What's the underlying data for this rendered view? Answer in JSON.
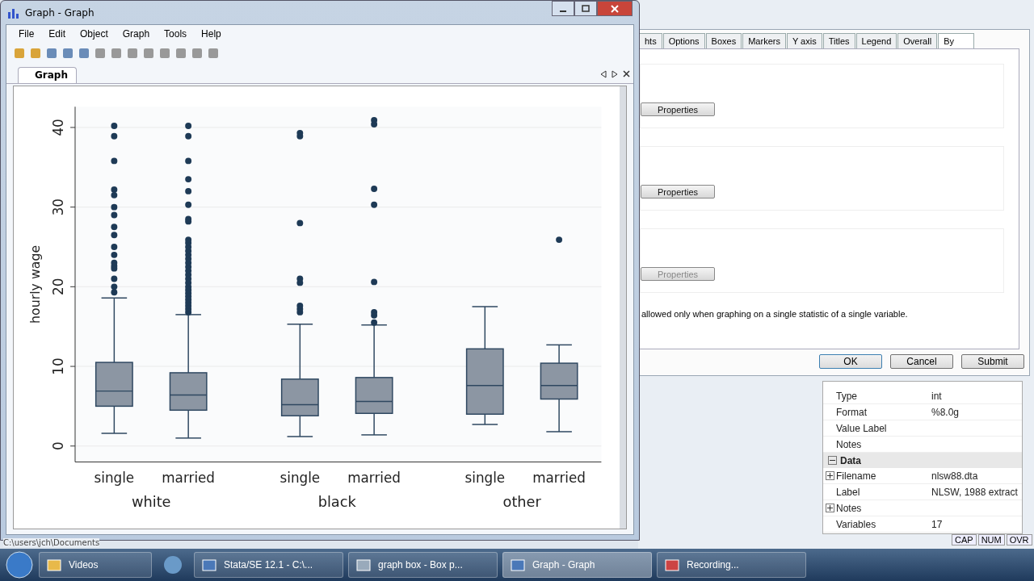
{
  "graph_window": {
    "title": "Graph - Graph",
    "menu": [
      "File",
      "Edit",
      "Object",
      "Graph",
      "Tools",
      "Help"
    ],
    "tab": {
      "label": "Graph",
      "selected": true
    },
    "chart": {
      "y_axis_title": "hourly wage",
      "y_ticks": [
        "0",
        "10",
        "20",
        "30",
        "40"
      ],
      "categories": [
        "single",
        "married",
        "single",
        "married",
        "single",
        "married"
      ],
      "groups": [
        "white",
        "black",
        "other"
      ]
    }
  },
  "dialog": {
    "tabs": [
      {
        "label": "hts",
        "selected": false
      },
      {
        "label": "Options",
        "selected": false
      },
      {
        "label": "Boxes",
        "selected": false
      },
      {
        "label": "Markers",
        "selected": false
      },
      {
        "label": "Y axis",
        "selected": false
      },
      {
        "label": "Titles",
        "selected": false
      },
      {
        "label": "Legend",
        "selected": false
      },
      {
        "label": "Overall",
        "selected": false
      },
      {
        "label": "By",
        "selected": true
      }
    ],
    "property_buttons": [
      {
        "label": "Properties",
        "disabled": false
      },
      {
        "label": "Properties",
        "disabled": false
      },
      {
        "label": "Properties",
        "disabled": true
      }
    ],
    "note": "allowed only when graphing on a single statistic of a single variable.",
    "buttons": [
      {
        "label": "OK",
        "default": true
      },
      {
        "label": "Cancel",
        "default": false
      },
      {
        "label": "Submit",
        "default": false
      }
    ]
  },
  "properties": {
    "rows": [
      {
        "name": "Type",
        "value": "int"
      },
      {
        "name": "Format",
        "value": "%8.0g"
      },
      {
        "name": "Value Label",
        "value": ""
      },
      {
        "name": "Notes",
        "value": ""
      }
    ],
    "section": {
      "title": "Data",
      "expanded": true,
      "rows": [
        {
          "name": "Filename",
          "value": "nlsw88.dta",
          "expandable": true
        },
        {
          "name": "Label",
          "value": "NLSW, 1988 extract",
          "expandable": false
        },
        {
          "name": "Notes",
          "value": "",
          "expandable": true
        },
        {
          "name": "Variables",
          "value": "17",
          "expandable": false
        }
      ]
    }
  },
  "status_bar": {
    "path": "C:\\users\\jch\\Documents",
    "indicators": [
      "CAP",
      "NUM",
      "OVR"
    ]
  },
  "taskbar": {
    "items": [
      {
        "label": "Videos",
        "selected": false
      },
      {
        "label": "Stata/SE 12.1 - C:\\...",
        "selected": false
      },
      {
        "label": "graph box - Box p...",
        "selected": false
      },
      {
        "label": "Graph - Graph",
        "selected": true
      },
      {
        "label": "Recording...",
        "selected": false
      }
    ]
  }
}
